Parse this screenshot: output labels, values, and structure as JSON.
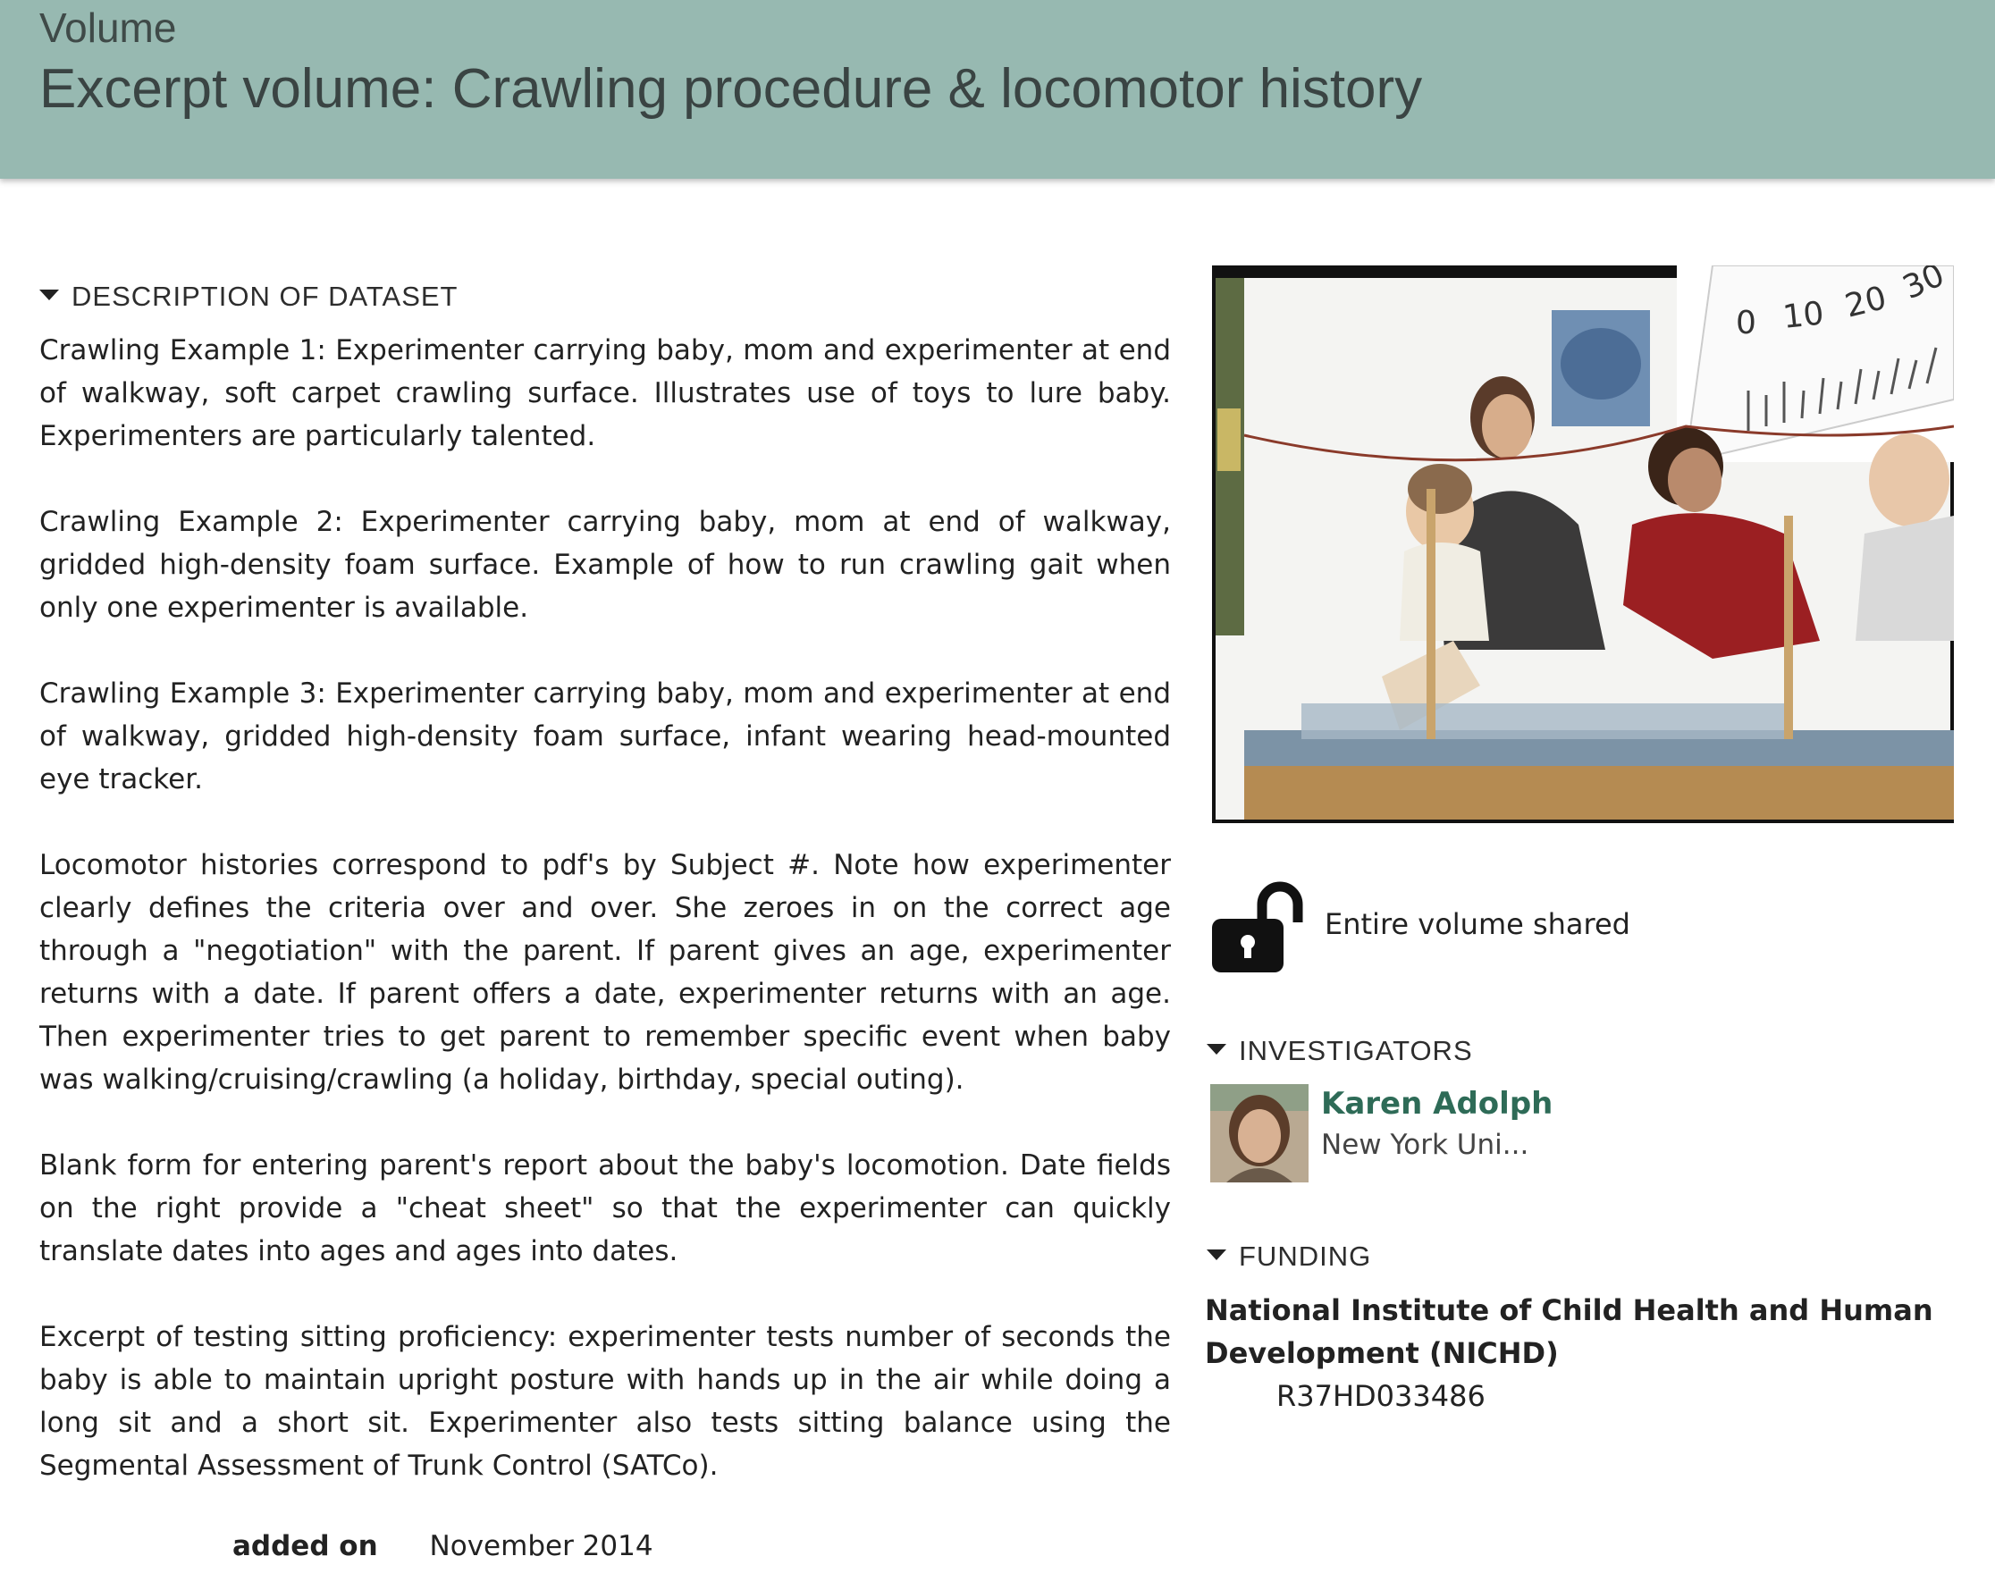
{
  "header": {
    "kind": "Volume",
    "title": "Excerpt volume: Crawling procedure & locomotor history"
  },
  "description": {
    "heading": "DESCRIPTION OF DATASET",
    "paragraphs": [
      "Crawling Example 1: Experimenter carrying baby, mom and experimenter at end of walkway, soft carpet crawling surface. Illustrates use of toys to lure baby. Experimenters are particularly talented.",
      "Crawling Example 2: Experimenter carrying baby, mom at end of walkway, gridded high-density foam surface. Example of how to run crawling gait when only one experimenter is available.",
      "Crawling Example 3: Experimenter carrying baby, mom and experimenter at end of walkway, gridded high-density foam surface, infant wearing head-mounted eye tracker.",
      "Locomotor histories correspond to pdf's by Subject #. Note how experimenter clearly defines the criteria over and over. She zeroes in on the correct age through a \"negotiation\" with the parent. If parent gives an age, experimenter returns with a date. If parent offers a date, experimenter returns with an age. Then experimenter tries to get parent to remember specific event when baby was walking/cruising/crawling (a holiday, birthday, special outing).",
      "Blank form for entering parent's report about the baby's locomotion. Date fields on the right provide a \"cheat sheet\" so that the experimenter can quickly translate dates into ages and ages into dates.",
      "Excerpt of testing sitting proficiency: experimenter tests number of seconds the baby is able to maintain upright posture with hands up in the air while doing a long sit and a short sit. Experimenter also tests sitting balance using the Segmental Assessment of Trunk Control (SATCo)."
    ]
  },
  "added": {
    "label": "added on",
    "value": "November 2014"
  },
  "thumbnail": {
    "ruler_labels": [
      "0",
      "10",
      "20",
      "30"
    ]
  },
  "sharing": {
    "icon": "unlocked-padlock-icon",
    "text": "Entire volume shared"
  },
  "investigators": {
    "heading": "INVESTIGATORS",
    "items": [
      {
        "name": "Karen Adolph",
        "affiliation": "New York Uni..."
      }
    ]
  },
  "funding": {
    "heading": "FUNDING",
    "agency": "National Institute of Child Health and Human Development (NICHD)",
    "grant": "R37HD033486"
  },
  "colors": {
    "header_bg": "#97b9b1",
    "investigator_link": "#2e6b57"
  }
}
